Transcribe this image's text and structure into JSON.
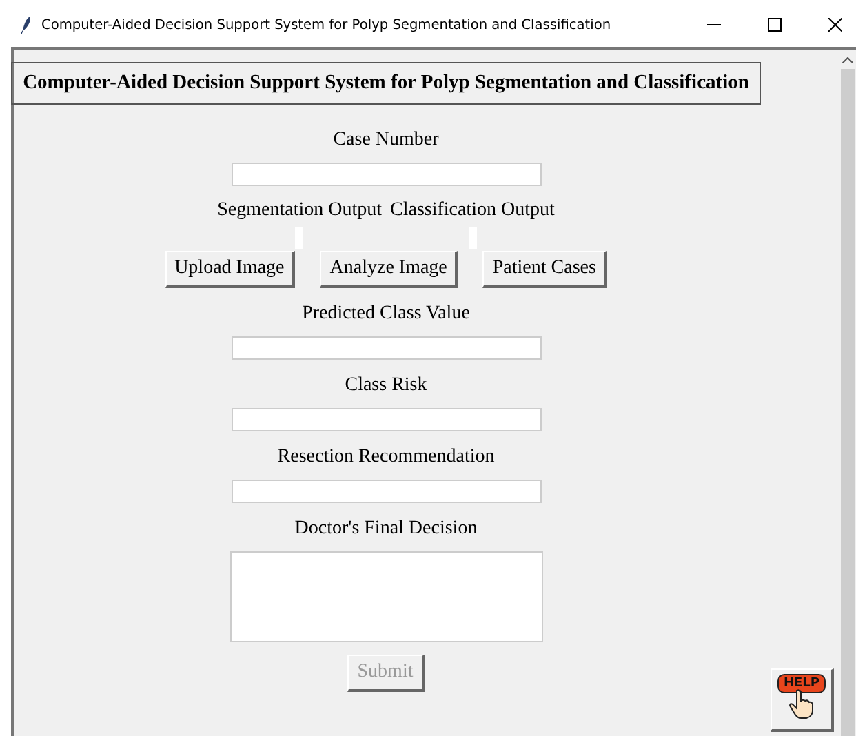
{
  "window": {
    "title": "Computer-Aided Decision Support System for Polyp Segmentation and Classification"
  },
  "header": "Computer-Aided Decision Support System for Polyp Segmentation and Classification",
  "case_number": {
    "label": "Case Number"
  },
  "outputs": [
    "Segmentation Output",
    "Classification Output"
  ],
  "buttons": [
    "Upload Image",
    "Analyze Image",
    "Patient Cases"
  ],
  "fields": [
    {
      "label": "Predicted Class Value",
      "kind": "entry"
    },
    {
      "label": "Class Risk",
      "kind": "entry"
    },
    {
      "label": "Resection Recommendation",
      "kind": "entry"
    },
    {
      "label": "Doctor's Final Decision",
      "kind": "text"
    }
  ],
  "submit": {
    "label": "Submit",
    "disabled": true
  },
  "help": {
    "label": "HELP"
  }
}
